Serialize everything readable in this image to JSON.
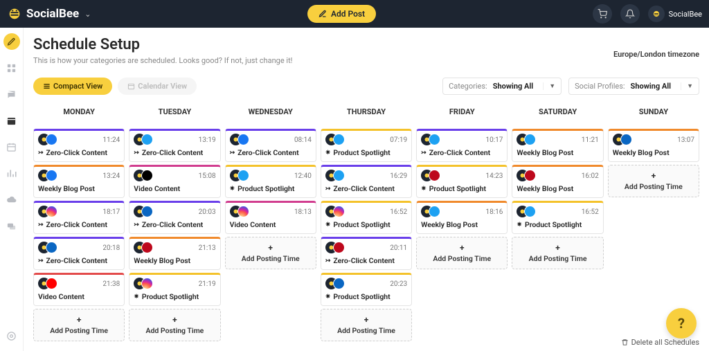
{
  "brand": "SocialBee",
  "topbar": {
    "add_post": "Add Post",
    "user": "SocialBee"
  },
  "page": {
    "title": "Schedule Setup",
    "subtitle": "This is how your categories are scheduled. Looks good? If not, just change it!",
    "timezone": "Europe/London timezone"
  },
  "view_toggle": {
    "compact": "Compact View",
    "calendar": "Calendar View"
  },
  "filters": {
    "categories_label": "Categories:",
    "categories_value": "Showing All",
    "profiles_label": "Social Profiles:",
    "profiles_value": "Showing All"
  },
  "days": [
    "MONDAY",
    "TUESDAY",
    "WEDNESDAY",
    "THURSDAY",
    "FRIDAY",
    "SATURDAY",
    "SUNDAY"
  ],
  "add_slot_label": "Add Posting Time",
  "delete_all": "Delete all Schedules",
  "slots": {
    "mon": [
      {
        "time": "11:24",
        "title": "Zero-Click Content",
        "color": "c-purple",
        "social": "s-fb",
        "glyph": "↣"
      },
      {
        "time": "13:24",
        "title": "Weekly Blog Post",
        "color": "c-orange",
        "social": "s-fb",
        "glyph": ""
      },
      {
        "time": "18:17",
        "title": "Zero-Click Content",
        "color": "c-purple",
        "social": "s-ig",
        "glyph": "↣"
      },
      {
        "time": "20:18",
        "title": "Zero-Click Content",
        "color": "c-purple",
        "social": "s-li",
        "glyph": "↣"
      },
      {
        "time": "21:38",
        "title": "Video Content",
        "color": "c-red",
        "social": "s-yt",
        "glyph": ""
      }
    ],
    "tue": [
      {
        "time": "13:19",
        "title": "Zero-Click Content",
        "color": "c-purple",
        "social": "s-tw",
        "glyph": "↣"
      },
      {
        "time": "15:08",
        "title": "Video Content",
        "color": "c-pink",
        "social": "s-tt",
        "glyph": ""
      },
      {
        "time": "20:03",
        "title": "Zero-Click Content",
        "color": "c-purple",
        "social": "s-li",
        "glyph": "↣"
      },
      {
        "time": "21:13",
        "title": "Weekly Blog Post",
        "color": "c-orange",
        "social": "s-pin",
        "glyph": ""
      },
      {
        "time": "21:19",
        "title": "Product Spotlight",
        "color": "c-yellow",
        "social": "s-ig",
        "glyph": "✷"
      }
    ],
    "wed": [
      {
        "time": "08:14",
        "title": "Zero-Click Content",
        "color": "c-purple",
        "social": "s-fb",
        "glyph": "↣"
      },
      {
        "time": "12:40",
        "title": "Product Spotlight",
        "color": "c-yellow",
        "social": "s-tw",
        "glyph": "✷"
      },
      {
        "time": "18:13",
        "title": "Video Content",
        "color": "c-pink",
        "social": "s-ig",
        "glyph": ""
      }
    ],
    "thu": [
      {
        "time": "07:19",
        "title": "Product Spotlight",
        "color": "c-yellow",
        "social": "s-tw",
        "glyph": "✷"
      },
      {
        "time": "16:29",
        "title": "Zero-Click Content",
        "color": "c-purple",
        "social": "s-tw",
        "glyph": "↣"
      },
      {
        "time": "16:52",
        "title": "Product Spotlight",
        "color": "c-yellow",
        "social": "s-ig",
        "glyph": "✷"
      },
      {
        "time": "20:11",
        "title": "Zero-Click Content",
        "color": "c-purple",
        "social": "s-pin",
        "glyph": "↣"
      },
      {
        "time": "20:23",
        "title": "Product Spotlight",
        "color": "c-yellow",
        "social": "s-li",
        "glyph": "✷"
      }
    ],
    "fri": [
      {
        "time": "10:17",
        "title": "Zero-Click Content",
        "color": "c-purple",
        "social": "s-tw",
        "glyph": "↣"
      },
      {
        "time": "14:23",
        "title": "Product Spotlight",
        "color": "c-yellow",
        "social": "s-pin",
        "glyph": "✷"
      },
      {
        "time": "18:16",
        "title": "Weekly Blog Post",
        "color": "c-orange",
        "social": "s-tw",
        "glyph": ""
      }
    ],
    "sat": [
      {
        "time": "11:21",
        "title": "Weekly Blog Post",
        "color": "c-orange",
        "social": "s-tw",
        "glyph": ""
      },
      {
        "time": "16:02",
        "title": "Weekly Blog Post",
        "color": "c-orange",
        "social": "s-pin",
        "glyph": ""
      },
      {
        "time": "16:52",
        "title": "Product Spotlight",
        "color": "c-yellow",
        "social": "s-tw",
        "glyph": "✷"
      }
    ],
    "sun": [
      {
        "time": "13:07",
        "title": "Weekly Blog Post",
        "color": "c-orange",
        "social": "s-li",
        "glyph": ""
      }
    ]
  }
}
